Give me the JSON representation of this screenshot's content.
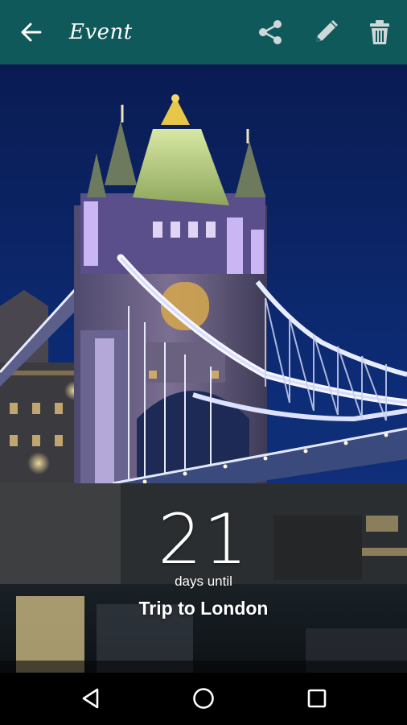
{
  "appbar": {
    "title": "Event",
    "background": "#10595a",
    "icons": {
      "back": "arrow-back-icon",
      "share": "share-icon",
      "edit": "pencil-icon",
      "delete": "trash-icon"
    }
  },
  "countdown": {
    "number": "21",
    "caption": "days until",
    "event_name": "Trip to London"
  },
  "background_image": {
    "subject": "tower-bridge-night-photo"
  },
  "navbar": {
    "icons": {
      "back": "nav-back-triangle-icon",
      "home": "nav-home-circle-icon",
      "recent": "nav-recent-square-icon"
    }
  }
}
